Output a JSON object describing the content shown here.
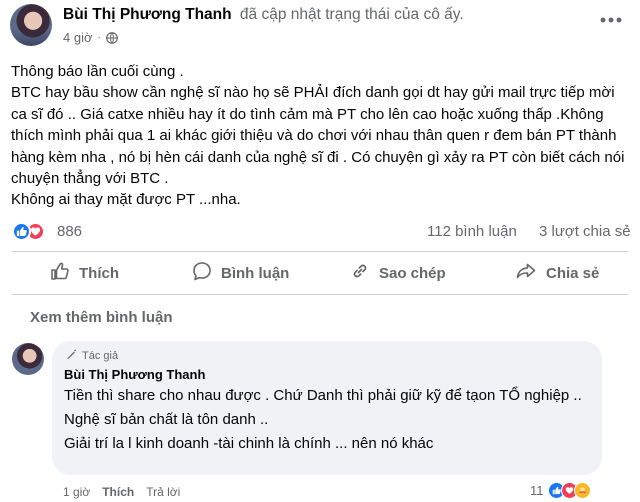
{
  "post": {
    "author": "Bùi Thị Phương Thanh",
    "action": "đã cập nhật trạng thái của cô ấy.",
    "time": "4 giờ",
    "dot": "·",
    "body": [
      "Thông báo lần cuối cùng .",
      "BTC hay bầu show cần nghệ sĩ nào họ sẽ PHẢI đích danh gọi dt hay gửi mail trực tiếp mời ca sĩ đó .. Giá catxe nhiều hay ít do tình cảm mà PT cho lên cao hoặc xuống thấp .Không thích mình phải qua 1 ai khác giới thiệu và do chơi với nhau thân quen r đem bán PT thành hàng kèm nha , nó bị hèn cái danh của nghệ sĩ đi . Có chuyện gì xảy ra PT còn biết cách nói chuyện thẳng với BTC .",
      "Không ai thay mặt được  PT ...nha."
    ],
    "reaction_count": "886",
    "comment_count": "112 bình luận",
    "share_count": "3 lượt chia sẻ"
  },
  "actions": {
    "like": "Thích",
    "comment": "Bình luận",
    "copy": "Sao chép",
    "share": "Chia sẻ"
  },
  "more_comments": "Xem thêm bình luận",
  "comment": {
    "badge": "Tác giả",
    "author": "Bùi Thị Phương Thanh",
    "lines": [
      "Tiền thì share cho nhau được . Chứ Danh thì phải giữ kỹ để tạon TỔ nghiệp ..",
      "Nghệ sĩ bản chất là tôn danh ..",
      "Giải trí la l kinh doanh -tài chinh là chính ... nên nó khác"
    ],
    "time": "1 giờ",
    "like": "Thích",
    "reply": "Trả lời",
    "reaction_count": "11"
  },
  "colors": {
    "text": "#050505",
    "secondary": "#65676b",
    "like_blue": "#1877f2",
    "love_red": "#f33e58",
    "care_yellow": "#f7b928",
    "bubble": "#f0f2f5",
    "divider": "#ced0d4"
  },
  "icons": {
    "globe": "globe-icon",
    "more": "more-horizontal-icon",
    "like": "thumbs-up-icon",
    "comment": "speech-bubble-icon",
    "copy": "copy-icon",
    "share": "share-arrow-icon",
    "badge": "pencil-icon"
  }
}
